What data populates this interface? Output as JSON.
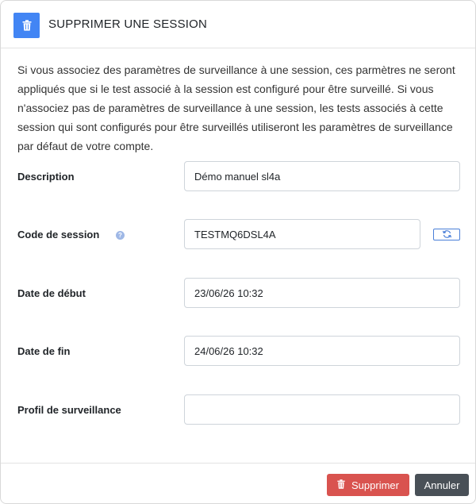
{
  "modal": {
    "title": "SUPPRIMER UNE SESSION",
    "header_icon": "trash-icon",
    "accent_color": "#4285f4",
    "info_text": "Si vous associez des paramètres de surveillance à une session, ces parmètres ne seront appliqués que si le test associé à la session est configuré pour être surveillé. Si vous n'associez pas de paramètres de surveillance à une session, les tests associés à cette session qui sont configurés pour être surveillés utiliseront les paramètres de surveillance par défaut de votre compte."
  },
  "form": {
    "description": {
      "label": "Description",
      "value": "Démo manuel sl4a"
    },
    "session_code": {
      "label": "Code de session",
      "help": "?",
      "value": "TESTMQ6DSL4A",
      "refresh_icon": "refresh-icon"
    },
    "start_date": {
      "label": "Date de début",
      "value": "23/06/26 10:32"
    },
    "end_date": {
      "label": "Date de fin",
      "value": "24/06/26 10:32"
    },
    "proctoring_profile": {
      "label": "Profil de surveillance",
      "value": ""
    }
  },
  "footer": {
    "delete_label": "Supprimer",
    "delete_color": "#d9534f",
    "cancel_label": "Annuler",
    "cancel_color": "#495057"
  }
}
